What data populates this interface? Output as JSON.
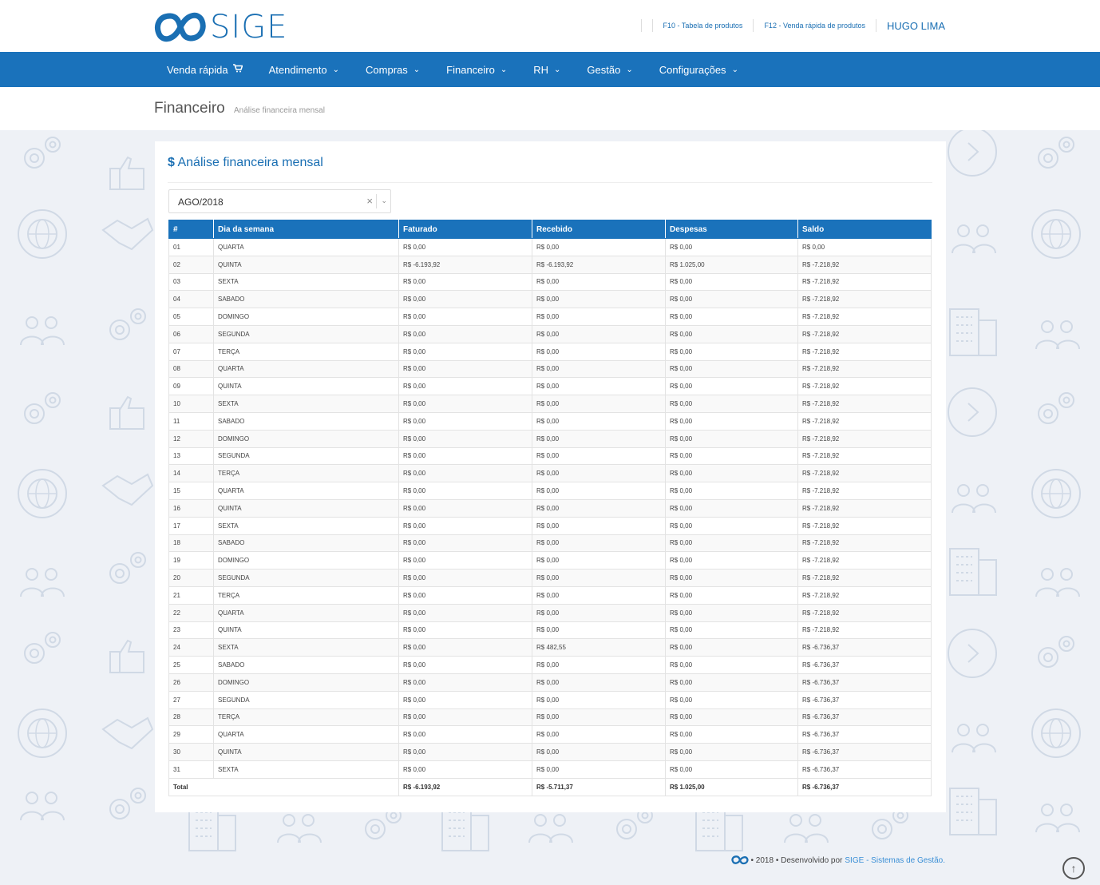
{
  "header": {
    "logo_text": "SIGE",
    "link_products_table": "F10 - Tabela de produtos",
    "link_quick_sale": "F12 - Venda rápida de produtos",
    "user_name": "HUGO LIMA"
  },
  "nav": {
    "items": [
      "Venda rápida",
      "Atendimento",
      "Compras",
      "Financeiro",
      "RH",
      "Gestão",
      "Configurações"
    ]
  },
  "page": {
    "title": "Financeiro",
    "subtitle": "Análise financeira mensal"
  },
  "card": {
    "title_icon": "$",
    "title": "Análise financeira mensal",
    "month_select_value": "AGO/2018",
    "clear_symbol": "×",
    "arrow_symbol": "⌄"
  },
  "table": {
    "headers": [
      "#",
      "Dia da semana",
      "Faturado",
      "Recebido",
      "Despesas",
      "Saldo"
    ],
    "rows": [
      [
        "01",
        "QUARTA",
        "R$ 0,00",
        "R$ 0,00",
        "R$ 0,00",
        "R$ 0,00"
      ],
      [
        "02",
        "QUINTA",
        "R$ -6.193,92",
        "R$ -6.193,92",
        "R$ 1.025,00",
        "R$ -7.218,92"
      ],
      [
        "03",
        "SEXTA",
        "R$ 0,00",
        "R$ 0,00",
        "R$ 0,00",
        "R$ -7.218,92"
      ],
      [
        "04",
        "SABADO",
        "R$ 0,00",
        "R$ 0,00",
        "R$ 0,00",
        "R$ -7.218,92"
      ],
      [
        "05",
        "DOMINGO",
        "R$ 0,00",
        "R$ 0,00",
        "R$ 0,00",
        "R$ -7.218,92"
      ],
      [
        "06",
        "SEGUNDA",
        "R$ 0,00",
        "R$ 0,00",
        "R$ 0,00",
        "R$ -7.218,92"
      ],
      [
        "07",
        "TERÇA",
        "R$ 0,00",
        "R$ 0,00",
        "R$ 0,00",
        "R$ -7.218,92"
      ],
      [
        "08",
        "QUARTA",
        "R$ 0,00",
        "R$ 0,00",
        "R$ 0,00",
        "R$ -7.218,92"
      ],
      [
        "09",
        "QUINTA",
        "R$ 0,00",
        "R$ 0,00",
        "R$ 0,00",
        "R$ -7.218,92"
      ],
      [
        "10",
        "SEXTA",
        "R$ 0,00",
        "R$ 0,00",
        "R$ 0,00",
        "R$ -7.218,92"
      ],
      [
        "11",
        "SABADO",
        "R$ 0,00",
        "R$ 0,00",
        "R$ 0,00",
        "R$ -7.218,92"
      ],
      [
        "12",
        "DOMINGO",
        "R$ 0,00",
        "R$ 0,00",
        "R$ 0,00",
        "R$ -7.218,92"
      ],
      [
        "13",
        "SEGUNDA",
        "R$ 0,00",
        "R$ 0,00",
        "R$ 0,00",
        "R$ -7.218,92"
      ],
      [
        "14",
        "TERÇA",
        "R$ 0,00",
        "R$ 0,00",
        "R$ 0,00",
        "R$ -7.218,92"
      ],
      [
        "15",
        "QUARTA",
        "R$ 0,00",
        "R$ 0,00",
        "R$ 0,00",
        "R$ -7.218,92"
      ],
      [
        "16",
        "QUINTA",
        "R$ 0,00",
        "R$ 0,00",
        "R$ 0,00",
        "R$ -7.218,92"
      ],
      [
        "17",
        "SEXTA",
        "R$ 0,00",
        "R$ 0,00",
        "R$ 0,00",
        "R$ -7.218,92"
      ],
      [
        "18",
        "SABADO",
        "R$ 0,00",
        "R$ 0,00",
        "R$ 0,00",
        "R$ -7.218,92"
      ],
      [
        "19",
        "DOMINGO",
        "R$ 0,00",
        "R$ 0,00",
        "R$ 0,00",
        "R$ -7.218,92"
      ],
      [
        "20",
        "SEGUNDA",
        "R$ 0,00",
        "R$ 0,00",
        "R$ 0,00",
        "R$ -7.218,92"
      ],
      [
        "21",
        "TERÇA",
        "R$ 0,00",
        "R$ 0,00",
        "R$ 0,00",
        "R$ -7.218,92"
      ],
      [
        "22",
        "QUARTA",
        "R$ 0,00",
        "R$ 0,00",
        "R$ 0,00",
        "R$ -7.218,92"
      ],
      [
        "23",
        "QUINTA",
        "R$ 0,00",
        "R$ 0,00",
        "R$ 0,00",
        "R$ -7.218,92"
      ],
      [
        "24",
        "SEXTA",
        "R$ 0,00",
        "R$ 482,55",
        "R$ 0,00",
        "R$ -6.736,37"
      ],
      [
        "25",
        "SABADO",
        "R$ 0,00",
        "R$ 0,00",
        "R$ 0,00",
        "R$ -6.736,37"
      ],
      [
        "26",
        "DOMINGO",
        "R$ 0,00",
        "R$ 0,00",
        "R$ 0,00",
        "R$ -6.736,37"
      ],
      [
        "27",
        "SEGUNDA",
        "R$ 0,00",
        "R$ 0,00",
        "R$ 0,00",
        "R$ -6.736,37"
      ],
      [
        "28",
        "TERÇA",
        "R$ 0,00",
        "R$ 0,00",
        "R$ 0,00",
        "R$ -6.736,37"
      ],
      [
        "29",
        "QUARTA",
        "R$ 0,00",
        "R$ 0,00",
        "R$ 0,00",
        "R$ -6.736,37"
      ],
      [
        "30",
        "QUINTA",
        "R$ 0,00",
        "R$ 0,00",
        "R$ 0,00",
        "R$ -6.736,37"
      ],
      [
        "31",
        "SEXTA",
        "R$ 0,00",
        "R$ 0,00",
        "R$ 0,00",
        "R$ -6.736,37"
      ]
    ],
    "total": {
      "label": "Total",
      "faturado": "R$ -6.193,92",
      "recebido": "R$ -5.711,37",
      "despesas": "R$ 1.025,00",
      "saldo": "R$ -6.736,37"
    }
  },
  "footer": {
    "text": "• 2018 • Desenvolvido por",
    "link": "SIGE - Sistemas de Gestão."
  },
  "colors": {
    "brand_blue": "#1a72bb",
    "link_blue": "#1a6fb3",
    "background": "#eef1f6"
  },
  "icons": [
    "logo-infinity-icon",
    "cart-icon",
    "chevron-down-icon",
    "clear-icon",
    "arrow-up-icon",
    "gear-icon",
    "globe-icon",
    "thumbs-up-icon",
    "handshake-icon",
    "people-icon",
    "building-icon",
    "arrow-right-circle-icon"
  ]
}
